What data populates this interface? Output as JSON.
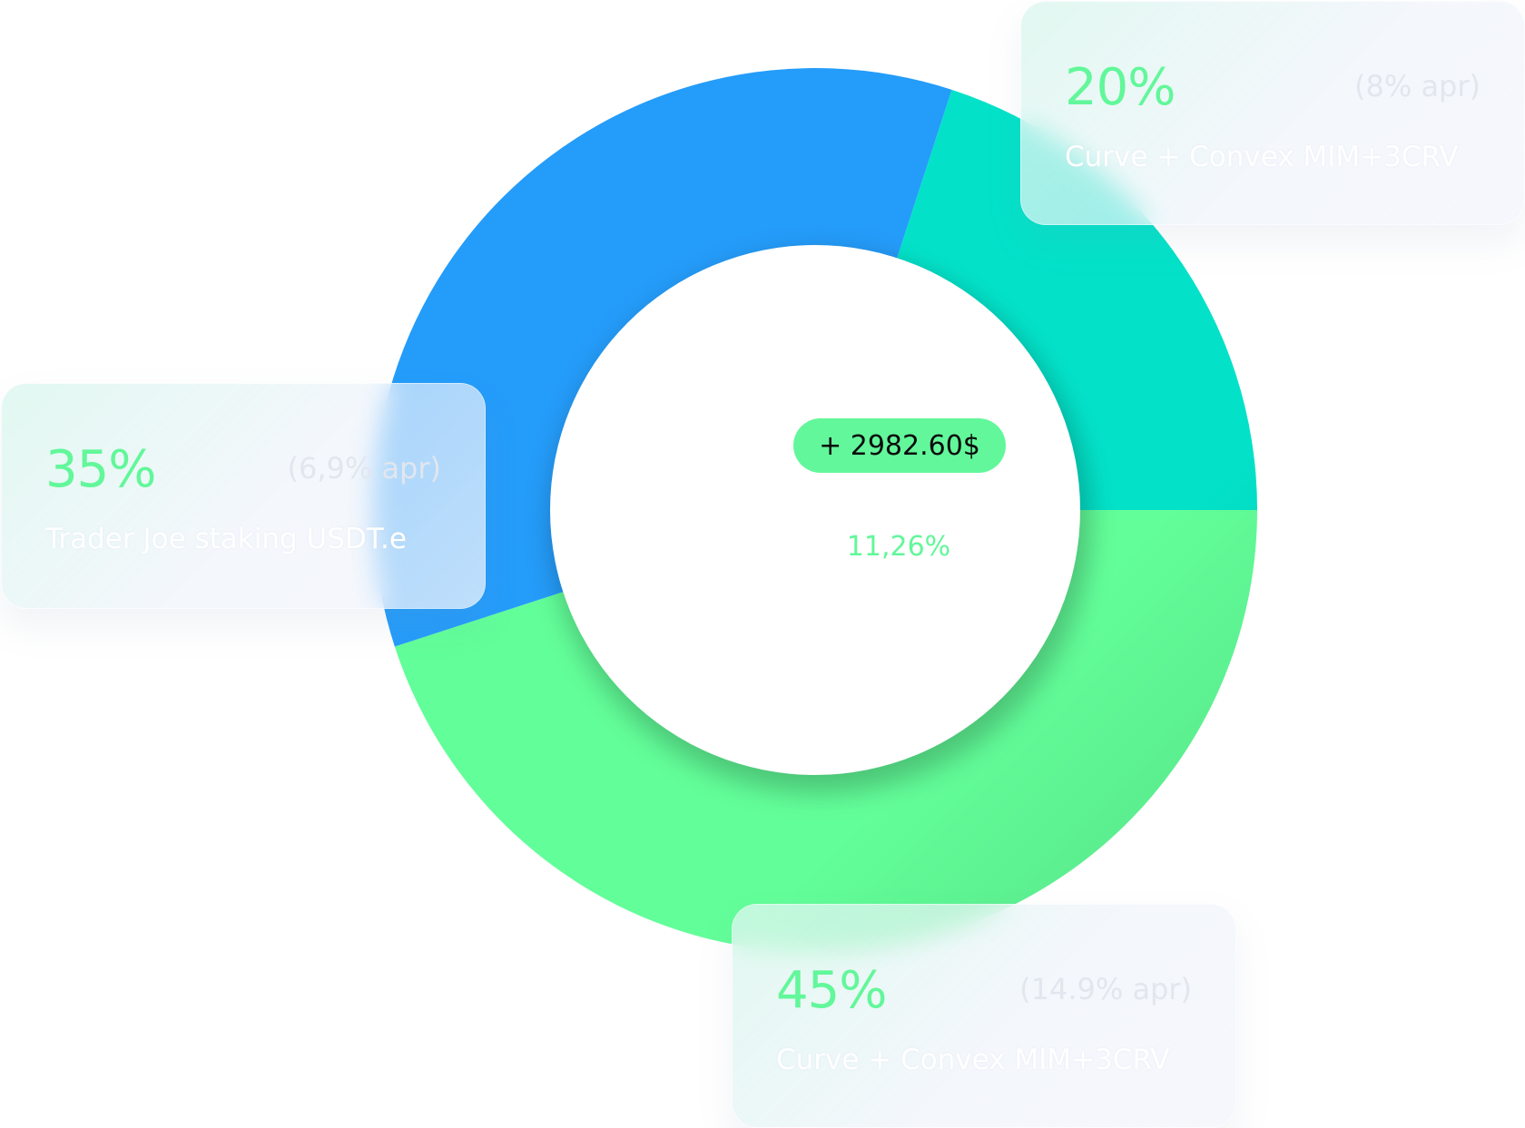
{
  "colors": {
    "blue": "#249cfa",
    "teal": "#03e2c9",
    "green": "#62fe99",
    "accent_green": "#62f79a"
  },
  "chart_data": {
    "type": "pie",
    "style": "donut",
    "slices": [
      {
        "label": "Curve + Convex MIM+3CRV",
        "value": 20,
        "value_label": "20%",
        "apr": "(8% apr)",
        "color": "#03e2c9"
      },
      {
        "label": "Curve + Convex MIM+3CRV",
        "value": 45,
        "value_label": "45%",
        "apr": "(14.9% apr)",
        "color": "#62fe99"
      },
      {
        "label": "Trader Joe staking USDT.e",
        "value": 35,
        "value_label": "35%",
        "apr": "(6,9% apr)",
        "color": "#249cfa"
      }
    ],
    "center": {
      "amount": "+ 2982.60$",
      "percent": "11,26%"
    }
  }
}
